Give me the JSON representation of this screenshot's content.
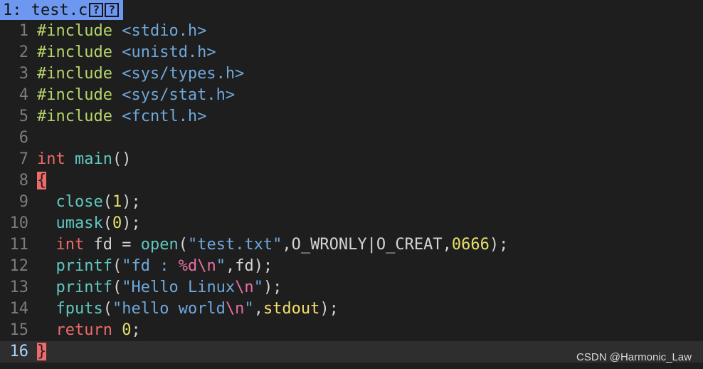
{
  "tab": {
    "label": "1: test.c",
    "icons": [
      "?",
      "?"
    ]
  },
  "lines": [
    {
      "n": "1",
      "tokens": [
        [
          "pre",
          "#include "
        ],
        [
          "inc",
          "<stdio.h>"
        ]
      ]
    },
    {
      "n": "2",
      "tokens": [
        [
          "pre",
          "#include "
        ],
        [
          "inc",
          "<unistd.h>"
        ]
      ]
    },
    {
      "n": "3",
      "tokens": [
        [
          "pre",
          "#include "
        ],
        [
          "inc",
          "<sys/types.h>"
        ]
      ]
    },
    {
      "n": "4",
      "tokens": [
        [
          "pre",
          "#include "
        ],
        [
          "inc",
          "<sys/stat.h>"
        ]
      ]
    },
    {
      "n": "5",
      "tokens": [
        [
          "pre",
          "#include "
        ],
        [
          "inc",
          "<fcntl.h>"
        ]
      ]
    },
    {
      "n": "6",
      "tokens": []
    },
    {
      "n": "7",
      "tokens": [
        [
          "kw",
          "int"
        ],
        [
          "pun",
          " "
        ],
        [
          "fn",
          "main"
        ],
        [
          "pun",
          "()"
        ]
      ]
    },
    {
      "n": "8",
      "tokens": [
        [
          "hl",
          "{"
        ]
      ]
    },
    {
      "n": "9",
      "tokens": [
        [
          "pun",
          "  "
        ],
        [
          "fn",
          "close"
        ],
        [
          "pun",
          "("
        ],
        [
          "num",
          "1"
        ],
        [
          "pun",
          ");"
        ]
      ]
    },
    {
      "n": "10",
      "tokens": [
        [
          "pun",
          "  "
        ],
        [
          "fn",
          "umask"
        ],
        [
          "pun",
          "("
        ],
        [
          "num",
          "0"
        ],
        [
          "pun",
          ");"
        ]
      ]
    },
    {
      "n": "11",
      "tokens": [
        [
          "pun",
          "  "
        ],
        [
          "kw",
          "int"
        ],
        [
          "pun",
          " fd = "
        ],
        [
          "fn",
          "open"
        ],
        [
          "pun",
          "("
        ],
        [
          "str",
          "\"test.txt\""
        ],
        [
          "pun",
          ",O_WRONLY|O_CREAT,"
        ],
        [
          "num",
          "0666"
        ],
        [
          "pun",
          ");"
        ]
      ]
    },
    {
      "n": "12",
      "tokens": [
        [
          "pun",
          "  "
        ],
        [
          "fn",
          "printf"
        ],
        [
          "pun",
          "("
        ],
        [
          "str",
          "\"fd : "
        ],
        [
          "esc",
          "%d\\n"
        ],
        [
          "str",
          "\""
        ],
        [
          "pun",
          ",fd);"
        ]
      ]
    },
    {
      "n": "13",
      "tokens": [
        [
          "pun",
          "  "
        ],
        [
          "fn",
          "printf"
        ],
        [
          "pun",
          "("
        ],
        [
          "str",
          "\"Hello Linux"
        ],
        [
          "esc",
          "\\n"
        ],
        [
          "str",
          "\""
        ],
        [
          "pun",
          ");"
        ]
      ]
    },
    {
      "n": "14",
      "tokens": [
        [
          "pun",
          "  "
        ],
        [
          "fn",
          "fputs"
        ],
        [
          "pun",
          "("
        ],
        [
          "str",
          "\"hello world"
        ],
        [
          "esc",
          "\\n"
        ],
        [
          "str",
          "\""
        ],
        [
          "pun",
          ","
        ],
        [
          "std",
          "stdout"
        ],
        [
          "pun",
          ");"
        ]
      ]
    },
    {
      "n": "15",
      "tokens": [
        [
          "pun",
          "  "
        ],
        [
          "kw",
          "return"
        ],
        [
          "pun",
          " "
        ],
        [
          "num",
          "0"
        ],
        [
          "pun",
          ";"
        ]
      ]
    },
    {
      "n": "16",
      "tokens": [
        [
          "hl",
          "}"
        ]
      ],
      "current": true
    }
  ],
  "watermark": "CSDN @Harmonic_Law"
}
